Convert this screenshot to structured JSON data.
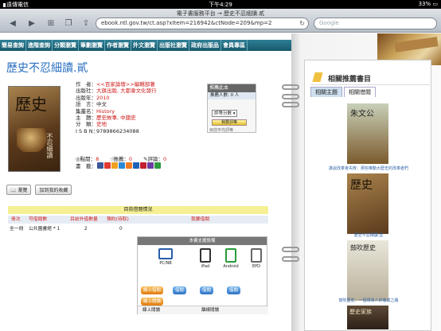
{
  "status": {
    "carrier": "遠傳電信",
    "time": "下午4:29",
    "battery": "33%"
  },
  "browser": {
    "page_title": "電子書服務平台 → 歷史不忍細讀.貳",
    "url": "ebook.ntl.gov.tw/ct.asp?xItem=216942&ctNode=209&mp=2",
    "search_placeholder": "Google"
  },
  "nav": [
    "簡易查詢",
    "進階查詢",
    "分類瀏覽",
    "筆劃瀏覽",
    "作者瀏覽",
    "外文瀏覽",
    "出版社瀏覽",
    "政府出版品",
    "會員專區"
  ],
  "book": {
    "title": "歷史不忍細讀.貳",
    "cover_text": "歷史",
    "cover_sub": "不忍細讀",
    "meta": [
      {
        "label": "作　者：",
        "value": "<<百家論壇>>編輯部著",
        "cls": "red"
      },
      {
        "label": "出版社：",
        "value": "大旗出版, 大都會文化發行",
        "cls": "red"
      },
      {
        "label": "出版年：",
        "value": "2010",
        "cls": "red"
      },
      {
        "label": "語　言：",
        "value": "中文",
        "cls": ""
      },
      {
        "label": "集叢名：",
        "value": "History",
        "cls": "red"
      },
      {
        "label": "主　題：",
        "value": "歷史故事, 中國史",
        "cls": "red"
      },
      {
        "label": "分　類：",
        "value": "史地",
        "cls": "red"
      },
      {
        "label": "I S B N：",
        "value": "9789866234088",
        "cls": ""
      }
    ]
  },
  "rating": {
    "head": "推薦此本",
    "count_label": "推薦人數: 0 人",
    "select": "評等分數",
    "button": "我要評等",
    "footer": "目前平均評等"
  },
  "stats": {
    "clicks_label": "點閱：",
    "clicks": "8",
    "recommend_label": "推薦：",
    "recommend": "0",
    "comments_label": "評論：",
    "comments": "0",
    "share_label": "書　籤："
  },
  "tools": {
    "view": "📖 瀏覽",
    "favorite": "加到我的收藏"
  },
  "holdings": {
    "title": "目前借閱情況",
    "columns": [
      "冊次",
      "可借閱數",
      "目前外借數量",
      "預約(待取)",
      "我要借閱"
    ],
    "row": {
      "vol": "全一冊",
      "lib": "公共圖書館 * 1",
      "borrowed": "2",
      "reserved": "0"
    }
  },
  "support": {
    "title": "本書支援設備",
    "devices": [
      "PC/NB",
      "iPad",
      "Android",
      "EPD"
    ],
    "buttons": {
      "online_borrow": "線上借閱",
      "online_read": "線上閱讀",
      "borrow1": "借閱",
      "borrow2": "借閱",
      "borrow3": "借閱"
    },
    "tail": [
      "線上閱讀",
      "離線閱讀"
    ]
  },
  "recommend": {
    "title": "相關推薦書目",
    "tabs": [
      "相關主題",
      "相關借閱"
    ],
    "items": [
      {
        "cover": "朱文公",
        "caption": "誰說改革會失敗：那些推動大歷史的改革者們"
      },
      {
        "cover": "歷史",
        "caption": "歷史不忍細讀.壹"
      },
      {
        "cover": "鼓吹歷史",
        "caption": "鼓吹歷史：一個領導人的養成之路"
      },
      {
        "cover": "歷史家族",
        "caption": ""
      }
    ]
  }
}
